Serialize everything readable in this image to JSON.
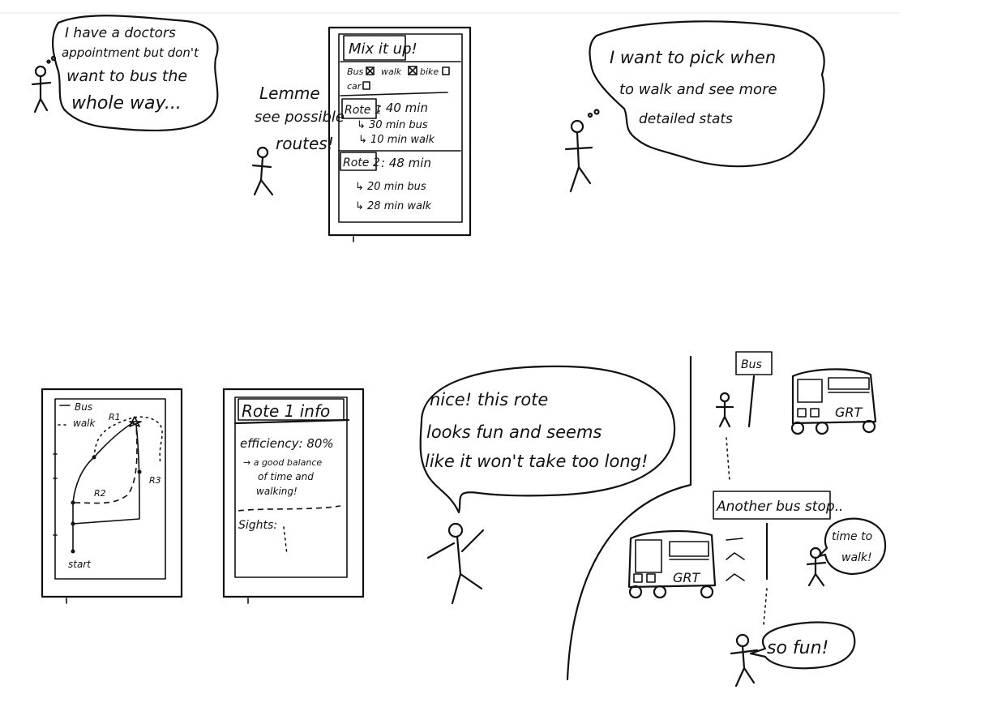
{
  "panel1": {
    "speech": [
      "I have a doctors",
      "appointment but don't",
      "want to bus the",
      "whole way..."
    ]
  },
  "panel2": {
    "thought": [
      "Lemme",
      "see possible",
      "routes!"
    ],
    "screen": {
      "title": "Mix it up!",
      "options_row1": [
        "Bus",
        "walk",
        "bike"
      ],
      "options_row2": [
        "car"
      ],
      "checked": {
        "Bus": true,
        "walk": true,
        "bike": false,
        "car": false
      },
      "route1": {
        "label": "Rote 1",
        "total": ": 40 min",
        "detail": [
          "↳ 30 min bus",
          "↳ 10 min walk"
        ]
      },
      "route2": {
        "label": "Rote 2",
        "total": ": 48 min",
        "detail": [
          "↳ 20 min bus",
          "↳ 28 min walk"
        ]
      }
    }
  },
  "panel3": {
    "speech": [
      "I want to pick when",
      "to walk and see more",
      "detailed stats"
    ]
  },
  "panel4": {
    "legend": [
      "Bus",
      "walk"
    ],
    "route_labels": [
      "R1",
      "R2",
      "R3"
    ],
    "start_label": "start"
  },
  "panel5": {
    "title": "Rote 1 info",
    "efficiency": "efficiency: 80%",
    "note": [
      "→ a good balance",
      "of time and",
      "walking!"
    ],
    "sights": "Sights:"
  },
  "panel6": {
    "speech": [
      "nice! this rote",
      "looks fun and seems",
      "like it won't take too long!"
    ]
  },
  "panel7": {
    "bus_sign": "Bus",
    "bus_text": "GRT",
    "another_stop": "Another bus stop..",
    "time_to_walk": [
      "time to",
      "walk!"
    ],
    "so_fun": "so fun!"
  }
}
